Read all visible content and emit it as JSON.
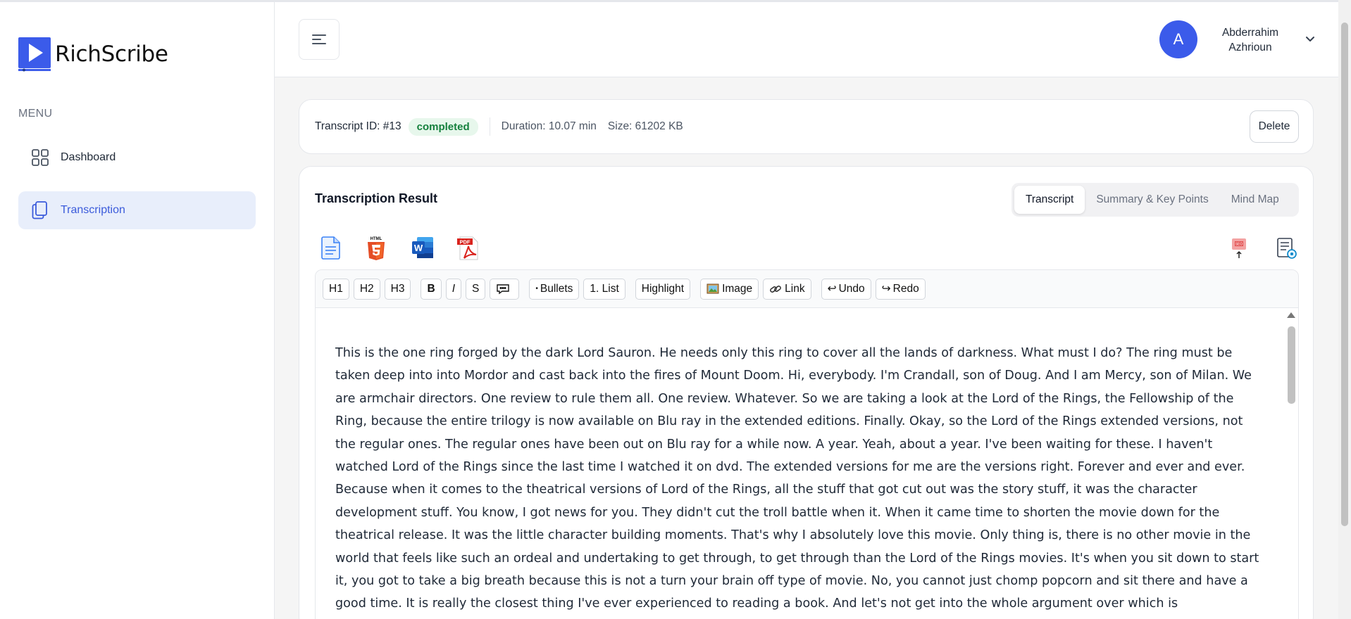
{
  "app": {
    "name": "RichScribe",
    "brand_color": "#3b5bea"
  },
  "sidebar": {
    "menu_label": "MENU",
    "items": [
      {
        "label": "Dashboard",
        "icon": "grid-icon",
        "active": false
      },
      {
        "label": "Transcription",
        "icon": "copy-icon",
        "active": true
      }
    ]
  },
  "header": {
    "user": {
      "initial": "A",
      "name": "Abderrahim Azhrioun"
    }
  },
  "info": {
    "transcript_id": "Transcript ID: #13",
    "status": "completed",
    "duration": "Duration: 10.07 min",
    "size": "Size: 61202 KB",
    "delete_label": "Delete"
  },
  "result": {
    "title": "Transcription Result",
    "tabs": [
      "Transcript",
      "Summary & Key Points",
      "Mind Map"
    ],
    "active_tab": "Transcript",
    "export_icons": [
      "txt-file-icon",
      "html5-icon",
      "word-icon",
      "pdf-icon"
    ],
    "action_icons": [
      "seo-upload-icon",
      "document-settings-icon"
    ],
    "toolbar": {
      "h1": "H1",
      "h2": "H2",
      "h3": "H3",
      "bold": "B",
      "italic": "I",
      "strike": "S",
      "bullets": "Bullets",
      "list": "1. List",
      "highlight": "Highlight",
      "image": "Image",
      "link": "Link",
      "undo": "Undo",
      "redo": "Redo"
    },
    "transcript_text": "This is the one ring forged by the dark Lord Sauron. He needs only this ring to cover all the lands of darkness. What must I do? The ring must be taken deep into into Mordor and cast back into the fires of Mount Doom. Hi, everybody. I'm Crandall, son of Doug. And I am Mercy, son of Milan. We are armchair directors. One review to rule them all. One review. Whatever. So we are taking a look at the Lord of the Rings, the Fellowship of the Ring, because the entire trilogy is now available on Blu ray in the extended editions. Finally. Okay, so the Lord of the Rings extended versions, not the regular ones. The regular ones have been out on Blu ray for a while now. A year. Yeah, about a year. I've been waiting for these. I haven't watched Lord of the Rings since the last time I watched it on dvd. The extended versions for me are the versions right. Forever and ever and ever. Because when it comes to the theatrical versions of Lord of the Rings, all the stuff that got cut out was the story stuff, it was the character development stuff. You know, I got news for you. They didn't cut the troll battle when it. When it came time to shorten the movie down for the theatrical release. It was the little character building moments. That's why I absolutely love this movie. Only thing is, there is no other movie in the world that feels like such an ordeal and undertaking to get through, to get through than the Lord of the Rings movies. It's when you sit down to start it, you got to take a big breath because this is not a turn your brain off type of movie. No, you cannot just chomp popcorn and sit there and have a good time. It is really the closest thing I've ever experienced to reading a book. And let's not get into the whole argument over which is"
  }
}
